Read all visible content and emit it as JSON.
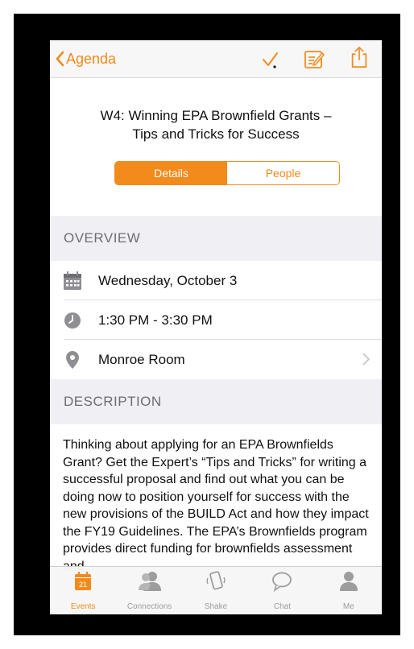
{
  "navbar": {
    "back_label": "Agenda"
  },
  "session": {
    "title_line1": "W4: Winning EPA Brownfield Grants –",
    "title_line2": "Tips and Tricks for Success"
  },
  "segment": {
    "details_label": "Details",
    "people_label": "People",
    "selected": "Details"
  },
  "overview": {
    "header": "OVERVIEW",
    "date": "Wednesday, October 3",
    "time": "1:30 PM - 3:30 PM",
    "location": "Monroe Room"
  },
  "description": {
    "header": "DESCRIPTION",
    "text": "Thinking about applying for an EPA Brownfields Grant? Get the Expert’s “Tips and Tricks” for writing a successful proposal and find out what you can be doing now to position yourself for success with the new provisions of the BUILD Act and how they impact the FY19 Guidelines. The EPA’s Brownfields program provides direct funding for brownfields assessment and"
  },
  "tabbar": {
    "calendar_day": "21",
    "tabs": [
      {
        "label": "Events",
        "icon": "calendar-icon"
      },
      {
        "label": "Connections",
        "icon": "people-icon"
      },
      {
        "label": "Shake",
        "icon": "shake-icon"
      },
      {
        "label": "Chat",
        "icon": "chat-icon"
      },
      {
        "label": "Me",
        "icon": "person-icon"
      }
    ],
    "active": "Events"
  },
  "colors": {
    "accent": "#f28a1c",
    "section_bg": "#efeff4",
    "inactive_tab": "#9d9d9d"
  }
}
